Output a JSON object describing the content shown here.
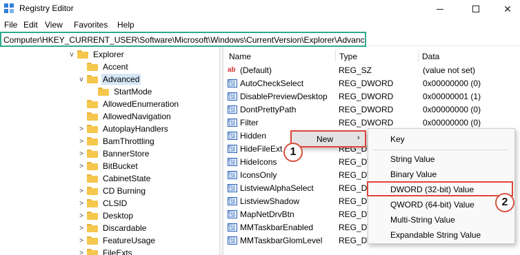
{
  "window": {
    "title": "Registry Editor"
  },
  "menu": [
    "File",
    "Edit",
    "View",
    "Favorites",
    "Help"
  ],
  "address": "Computer\\HKEY_CURRENT_USER\\Software\\Microsoft\\Windows\\CurrentVersion\\Explorer\\Advanced",
  "tree": [
    {
      "label": "Explorer",
      "expander": "v"
    },
    {
      "label": "Accent",
      "expander": ""
    },
    {
      "label": "Advanced",
      "expander": "v",
      "selected": true
    },
    {
      "label": "StartMode",
      "expander": ""
    },
    {
      "label": "AllowedEnumeration",
      "expander": ""
    },
    {
      "label": "AllowedNavigation",
      "expander": ""
    },
    {
      "label": "AutoplayHandlers",
      "expander": ">"
    },
    {
      "label": "BamThrottling",
      "expander": ">"
    },
    {
      "label": "BannerStore",
      "expander": ">"
    },
    {
      "label": "BitBucket",
      "expander": ">"
    },
    {
      "label": "CabinetState",
      "expander": ""
    },
    {
      "label": "CD Burning",
      "expander": ">"
    },
    {
      "label": "CLSID",
      "expander": ">"
    },
    {
      "label": "Desktop",
      "expander": ">"
    },
    {
      "label": "Discardable",
      "expander": ">"
    },
    {
      "label": "FeatureUsage",
      "expander": ">"
    },
    {
      "label": "FileExts",
      "expander": ">"
    }
  ],
  "columns": {
    "name": "Name",
    "type": "Type",
    "data": "Data"
  },
  "values": [
    {
      "name": "(Default)",
      "type": "REG_SZ",
      "data": "(value not set)",
      "icon": "string-value-icon"
    },
    {
      "name": "AutoCheckSelect",
      "type": "REG_DWORD",
      "data": "0x00000000 (0)",
      "icon": "binary-value-icon"
    },
    {
      "name": "DisablePreviewDesktop",
      "type": "REG_DWORD",
      "data": "0x00000001 (1)",
      "icon": "binary-value-icon"
    },
    {
      "name": "DontPrettyPath",
      "type": "REG_DWORD",
      "data": "0x00000000 (0)",
      "icon": "binary-value-icon"
    },
    {
      "name": "Filter",
      "type": "REG_DWORD",
      "data": "0x00000000 (0)",
      "icon": "binary-value-icon"
    },
    {
      "name": "Hidden",
      "type": "",
      "data": "",
      "icon": "binary-value-icon"
    },
    {
      "name": "HideFileExt",
      "type": "REG_DW",
      "data": "",
      "icon": "binary-value-icon"
    },
    {
      "name": "HideIcons",
      "type": "REG_DW",
      "data": "",
      "icon": "binary-value-icon"
    },
    {
      "name": "IconsOnly",
      "type": "REG_DW",
      "data": "",
      "icon": "binary-value-icon"
    },
    {
      "name": "ListviewAlphaSelect",
      "type": "REG_DW",
      "data": "",
      "icon": "binary-value-icon"
    },
    {
      "name": "ListviewShadow",
      "type": "REG_DW",
      "data": "",
      "icon": "binary-value-icon"
    },
    {
      "name": "MapNetDrvBtn",
      "type": "REG_DW",
      "data": "",
      "icon": "binary-value-icon"
    },
    {
      "name": "MMTaskbarEnabled",
      "type": "REG_DW",
      "data": "",
      "icon": "binary-value-icon"
    },
    {
      "name": "MMTaskbarGlomLevel",
      "type": "REG_DW",
      "data": "",
      "icon": "binary-value-icon"
    }
  ],
  "context_menu": {
    "new_label": "New",
    "arrow": "›"
  },
  "submenu": [
    "Key",
    "String Value",
    "Binary Value",
    "DWORD (32-bit) Value",
    "QWORD (64-bit) Value",
    "Multi-String Value",
    "Expandable String Value"
  ],
  "annotations": {
    "step1": "1",
    "step2": "2"
  },
  "colors": {
    "address_border": "#2eaa8c",
    "annotation_red": "#e0453a",
    "selection": "#d6e6f7"
  }
}
